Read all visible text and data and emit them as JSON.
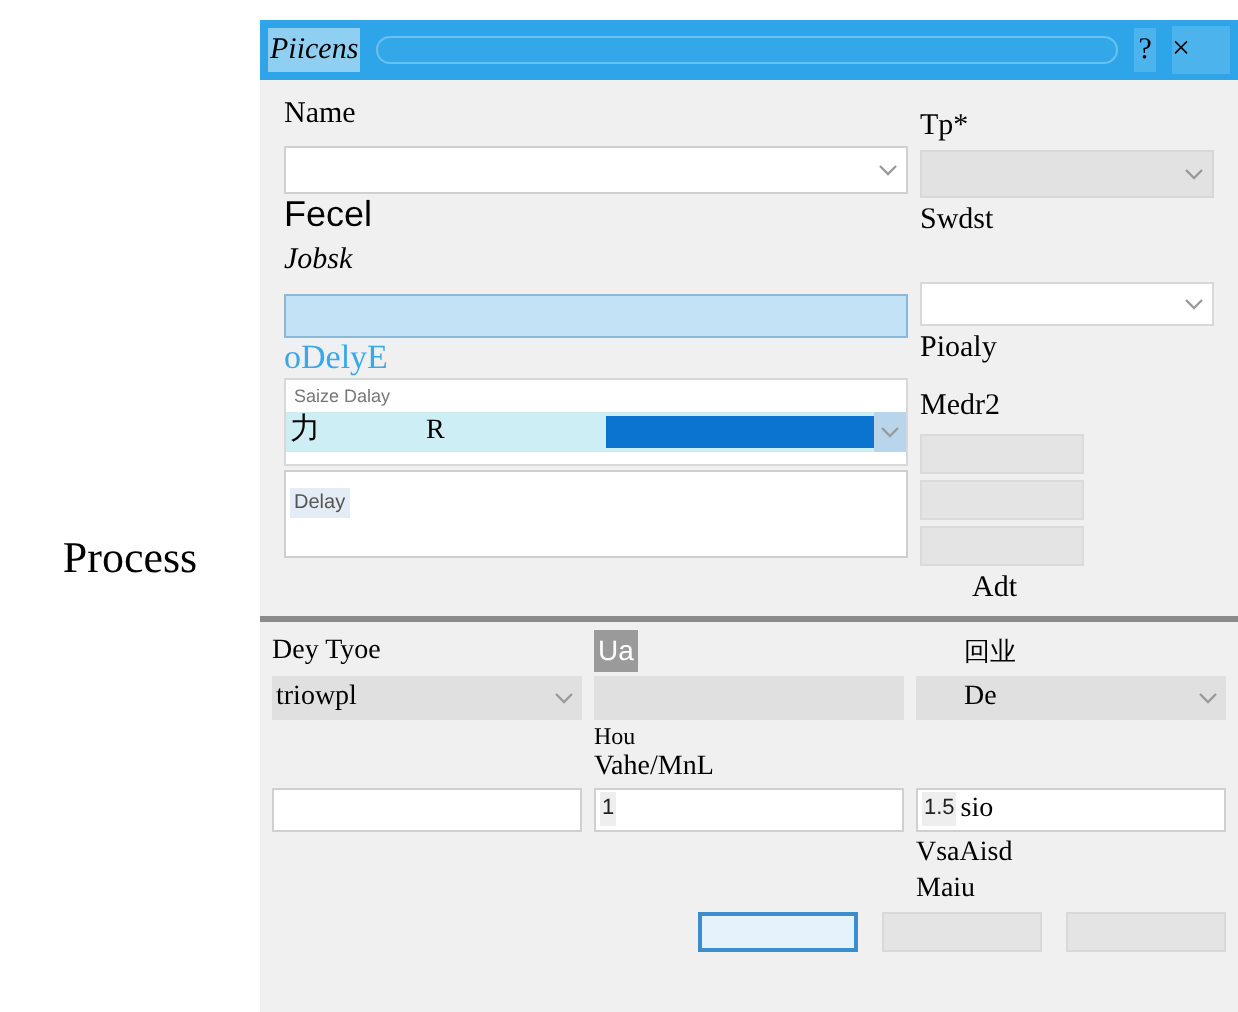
{
  "side_label": "Process",
  "window": {
    "title": "Piicens",
    "help": "?",
    "close": "×"
  },
  "general": {
    "name_label": "Name",
    "name_value": "Fecel",
    "type_label": "Tp*",
    "type_note": "Swdst"
  },
  "tasks": {
    "label": "Jobsk",
    "link": "oDelyE",
    "list_header": "Saize Dalay",
    "rows": [
      {
        "glyph": "力",
        "text": "R",
        "selected": true
      }
    ],
    "items": [
      {
        "text": "Delay"
      }
    ]
  },
  "side": {
    "priority_label": "Pioaly",
    "mode_label": "Medr2",
    "buttons": [
      {
        "disabled": true
      },
      {
        "disabled": true
      },
      {
        "disabled": true
      }
    ],
    "add_label": "Adt"
  },
  "details": {
    "type_label": "Dey Tyoe",
    "unit_label": "Ua",
    "mark": "回业",
    "selects": [
      {
        "kind": "combo",
        "value": "triowpl"
      },
      {
        "kind": "plain"
      },
      {
        "kind": "combo",
        "value": "De"
      }
    ],
    "hours_label": "Hou",
    "value_label": "Vahe/MnL",
    "inputs": [
      {
        "kind": "blank"
      },
      {
        "kind": "text",
        "value": "1"
      },
      {
        "kind": "text",
        "value": "1.5",
        "suffix": "sio"
      }
    ],
    "note_1": "VsaAisd",
    "note_2": "Maiu"
  },
  "footer": [
    {
      "default": true
    },
    {
      "default": false
    },
    {
      "default": false
    }
  ]
}
